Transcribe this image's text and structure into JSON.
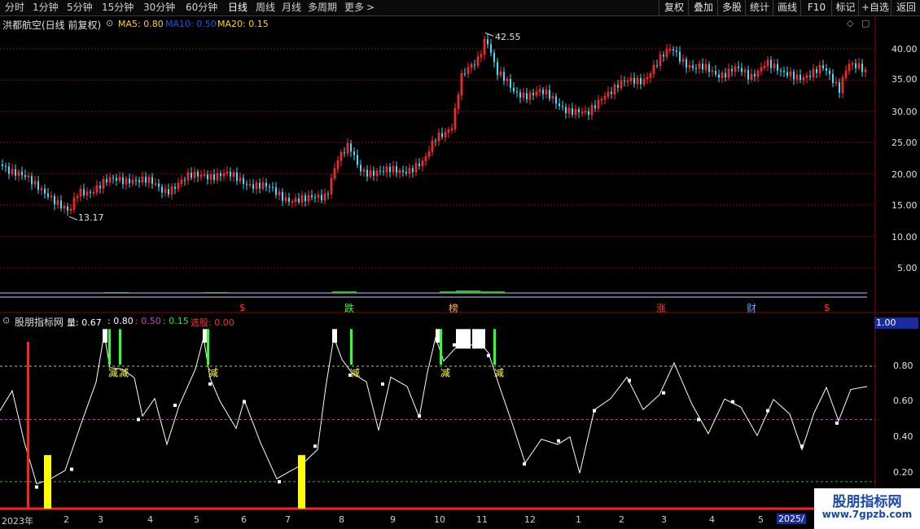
{
  "toolbar": {
    "periods": [
      "分时",
      "1分钟",
      "5分钟",
      "15分钟",
      "30分钟",
      "60分钟",
      "日线",
      "周线",
      "月线",
      "多周期",
      "更多"
    ],
    "active_period": "日线",
    "more_arrow": ">",
    "right_buttons": [
      "复权",
      "叠加",
      "多股",
      "统计",
      "画线",
      "F10",
      "标记",
      "+自选",
      "返回"
    ]
  },
  "main_chart": {
    "title": "洪都航空(日线 前复权)",
    "ma_labels": [
      {
        "text": "MA5: 0.80",
        "color": "#ffd700"
      },
      {
        "text": "MA10: 0.50",
        "color": "#2050ff"
      },
      {
        "text": "MA20: 0.15",
        "color": "#ffd700"
      }
    ],
    "y_ticks": [
      "40.00",
      "35.00",
      "30.00",
      "25.00",
      "20.00",
      "15.00",
      "10.00",
      "5.00"
    ],
    "high_label": "42.55",
    "low_label": "13.17",
    "event_marks": [
      {
        "text": "$",
        "color": "#ff3030"
      },
      {
        "text": "跌",
        "color": "#30ff30"
      },
      {
        "text": "榜",
        "color": "#ffb030"
      },
      {
        "text": "涨",
        "color": "#ff3030"
      },
      {
        "text": "财",
        "color": "#60a0ff"
      },
      {
        "text": "$",
        "color": "#ff3030"
      }
    ]
  },
  "indicator": {
    "name": "股朋指标网",
    "params": [
      {
        "text": "量: 0.67",
        "color": "#ffffff"
      },
      {
        "text": ": 0.80",
        "color": "#ffffff"
      },
      {
        "text": ": 0.50",
        "color": "#d040d0"
      },
      {
        "text": ": 0.15",
        "color": "#30e030"
      },
      {
        "text": "选股: 0.00",
        "color": "#ff3030"
      }
    ],
    "y_ticks": [
      "1.00",
      "0.80",
      "0.60",
      "0.40",
      "0.20"
    ],
    "current_value": "1.00",
    "reduce_label": "减"
  },
  "date_axis": {
    "labels": [
      "2023年",
      "2",
      "3",
      "4",
      "5",
      "6",
      "7",
      "8",
      "9",
      "10",
      "11",
      "12",
      "1",
      "2",
      "3",
      "4",
      "5",
      "2025/"
    ]
  },
  "watermark": {
    "line1": "股朋指标网",
    "line2": "www.7gpzb.com"
  },
  "colors": {
    "up": "#ff3030",
    "down": "#40e0ff",
    "grid": "#8b0000",
    "line": "#ffffff"
  }
}
